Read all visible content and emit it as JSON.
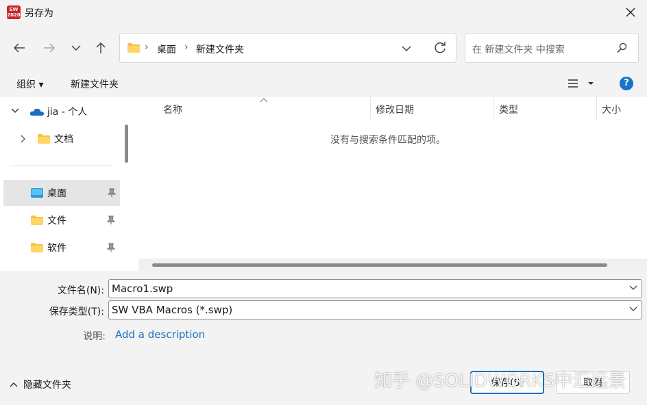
{
  "window": {
    "title": "另存为",
    "app_icon_text": "SW 2020"
  },
  "nav": {
    "back": "back-arrow-icon",
    "forward": "forward-arrow-icon",
    "recent": "chevron-down-icon",
    "up": "up-arrow-icon"
  },
  "address": {
    "crumbs": [
      "桌面",
      "新建文件夹"
    ]
  },
  "search": {
    "placeholder": "在 新建文件夹 中搜索"
  },
  "commandbar": {
    "organize": "组织 ▾",
    "new_folder": "新建文件夹"
  },
  "sidebar": {
    "items": [
      {
        "label": "jia - 个人"
      },
      {
        "label": "文档"
      },
      {
        "label": "桌面"
      },
      {
        "label": "文件"
      },
      {
        "label": "软件"
      }
    ]
  },
  "columns": [
    "名称",
    "修改日期",
    "类型",
    "大小"
  ],
  "empty_message": "没有与搜索条件匹配的项。",
  "form": {
    "filename_label": "文件名(N):",
    "filename_value": "Macro1.swp",
    "filetype_label": "保存类型(T):",
    "filetype_value": "SW VBA Macros (*.swp)",
    "desc_label": "说明:",
    "desc_link": "Add a description"
  },
  "footer": {
    "hide_folders": "隐藏文件夹",
    "save": "保存(S)",
    "cancel": "取消"
  },
  "watermark": "知乎 @SOLIDWORKS中汇远景",
  "colors": {
    "accent": "#1a6fbf",
    "chrome": "#f3f3f3",
    "folder": "#f5c242"
  }
}
